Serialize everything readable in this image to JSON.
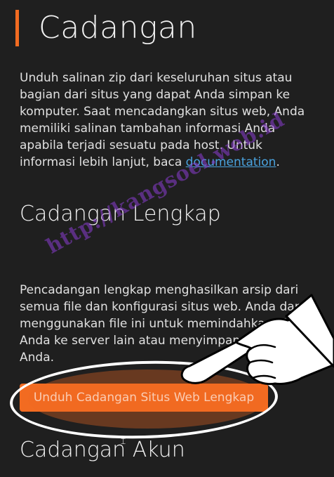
{
  "header": {
    "title": "Cadangan"
  },
  "intro": {
    "text": "Unduh salinan zip dari keseluruhan situs atau bagian dari situs yang dapat Anda simpan ke komputer. Saat mencadangkan situs web, Anda memiliki salinan tambahan informasi Anda apabila terjadi sesuatu pada host. Untuk informasi lebih lanjut, baca ",
    "link_text": "documentation",
    "suffix": "."
  },
  "full_backup": {
    "heading": "Cadangan Lengkap",
    "description": "Pencadangan lengkap menghasilkan arsip dari semua file dan konfigurasi situs web. Anda dapat menggunakan file ini untuk memindahkan akun Anda ke server lain atau menyimpan salinan file Anda.",
    "button_label": "Unduh Cadangan Situs Web Lengkap"
  },
  "account_backup": {
    "heading": "Cadangan Akun"
  },
  "watermark": {
    "text": "http://kangsoel.web.id"
  },
  "colors": {
    "accent": "#f26b21",
    "link": "#4aa3df",
    "background": "#1f1f1f",
    "watermark": "#8a3cd2"
  },
  "icons": {
    "pointer": "pointing-hand-icon"
  }
}
